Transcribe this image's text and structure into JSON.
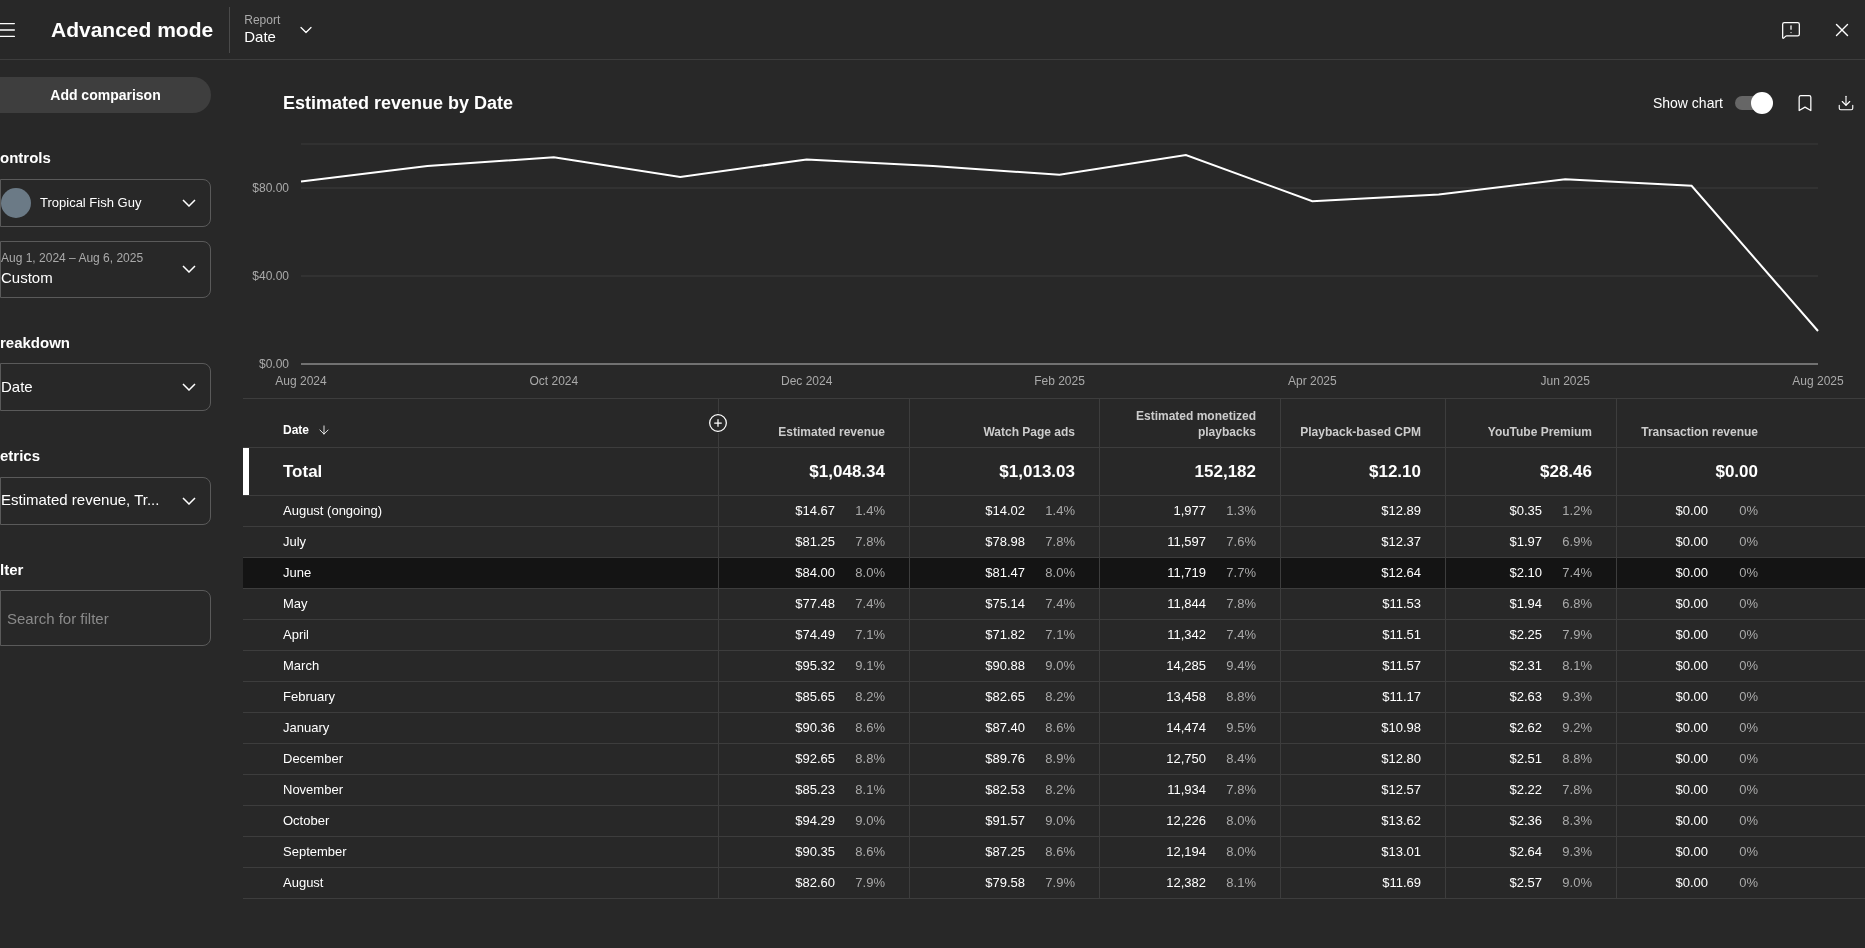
{
  "top_bar": {
    "title": "Advanced mode",
    "report_label": "Report",
    "report_value": "Date"
  },
  "sidebar": {
    "add_button": "Add comparison",
    "sections": [
      {
        "heading": "ontrols",
        "dropdowns": [
          {
            "kind": "channel",
            "value": "Tropical Fish Guy"
          },
          {
            "kind": "range",
            "caption": "Aug 1, 2024 – Aug 6, 2025",
            "value": "Custom"
          }
        ]
      },
      {
        "heading": "reakdown",
        "dropdowns": [
          {
            "kind": "plain",
            "value": "Date"
          }
        ]
      },
      {
        "heading": "etrics",
        "dropdowns": [
          {
            "kind": "plain",
            "value": "Estimated revenue, Tr..."
          }
        ]
      },
      {
        "heading": "lter",
        "dropdowns": [
          {
            "kind": "search",
            "placeholder": "Search for filter"
          }
        ]
      }
    ]
  },
  "chart": {
    "title": "Estimated revenue by Date",
    "show_chart_label": "Show chart",
    "show_chart_on": true,
    "chart_data": {
      "type": "line",
      "categories": [
        "Aug 2024",
        null,
        "Oct 2024",
        null,
        "Dec 2024",
        null,
        "Feb 2025",
        null,
        "Apr 2025",
        null,
        "Jun 2025",
        null,
        "Aug 2025"
      ],
      "series": [
        {
          "color": "#ffffff",
          "values": [
            83,
            90,
            94,
            85,
            93,
            90,
            86,
            95,
            74,
            77,
            84,
            81,
            15
          ]
        }
      ],
      "ylim": [
        0,
        100
      ],
      "yticks": [
        {
          "value": 0,
          "label": "$0.00"
        },
        {
          "value": 40,
          "label": "$40.00"
        },
        {
          "value": 80,
          "label": "$80.00"
        }
      ]
    }
  },
  "table": {
    "date_column": "Date",
    "columns": [
      {
        "heading": "Estimated revenue"
      },
      {
        "heading": "Watch Page ads"
      },
      {
        "heading": "Estimated monetized playbacks"
      },
      {
        "heading": "Playback-based CPM"
      },
      {
        "heading": "YouTube Premium"
      },
      {
        "heading": "Transaction revenue"
      }
    ],
    "total": {
      "label": "Total",
      "values": [
        "$1,048.34",
        "$1,013.03",
        "152,182",
        "$12.10",
        "$28.46",
        "$0.00"
      ]
    },
    "rows": [
      {
        "label": "August (ongoing)",
        "selected": false,
        "cells": [
          [
            "$14.67",
            "1.4%"
          ],
          [
            "$14.02",
            "1.4%"
          ],
          [
            "1,977",
            "1.3%"
          ],
          [
            "$12.89"
          ],
          [
            "$0.35",
            "1.2%"
          ],
          [
            "$0.00",
            "0%"
          ]
        ]
      },
      {
        "label": "July",
        "selected": false,
        "cells": [
          [
            "$81.25",
            "7.8%"
          ],
          [
            "$78.98",
            "7.8%"
          ],
          [
            "11,597",
            "7.6%"
          ],
          [
            "$12.37"
          ],
          [
            "$1.97",
            "6.9%"
          ],
          [
            "$0.00",
            "0%"
          ]
        ]
      },
      {
        "label": "June",
        "selected": true,
        "cells": [
          [
            "$84.00",
            "8.0%"
          ],
          [
            "$81.47",
            "8.0%"
          ],
          [
            "11,719",
            "7.7%"
          ],
          [
            "$12.64"
          ],
          [
            "$2.10",
            "7.4%"
          ],
          [
            "$0.00",
            "0%"
          ]
        ]
      },
      {
        "label": "May",
        "selected": false,
        "cells": [
          [
            "$77.48",
            "7.4%"
          ],
          [
            "$75.14",
            "7.4%"
          ],
          [
            "11,844",
            "7.8%"
          ],
          [
            "$11.53"
          ],
          [
            "$1.94",
            "6.8%"
          ],
          [
            "$0.00",
            "0%"
          ]
        ]
      },
      {
        "label": "April",
        "selected": false,
        "cells": [
          [
            "$74.49",
            "7.1%"
          ],
          [
            "$71.82",
            "7.1%"
          ],
          [
            "11,342",
            "7.4%"
          ],
          [
            "$11.51"
          ],
          [
            "$2.25",
            "7.9%"
          ],
          [
            "$0.00",
            "0%"
          ]
        ]
      },
      {
        "label": "March",
        "selected": false,
        "cells": [
          [
            "$95.32",
            "9.1%"
          ],
          [
            "$90.88",
            "9.0%"
          ],
          [
            "14,285",
            "9.4%"
          ],
          [
            "$11.57"
          ],
          [
            "$2.31",
            "8.1%"
          ],
          [
            "$0.00",
            "0%"
          ]
        ]
      },
      {
        "label": "February",
        "selected": false,
        "cells": [
          [
            "$85.65",
            "8.2%"
          ],
          [
            "$82.65",
            "8.2%"
          ],
          [
            "13,458",
            "8.8%"
          ],
          [
            "$11.17"
          ],
          [
            "$2.63",
            "9.3%"
          ],
          [
            "$0.00",
            "0%"
          ]
        ]
      },
      {
        "label": "January",
        "selected": false,
        "cells": [
          [
            "$90.36",
            "8.6%"
          ],
          [
            "$87.40",
            "8.6%"
          ],
          [
            "14,474",
            "9.5%"
          ],
          [
            "$10.98"
          ],
          [
            "$2.62",
            "9.2%"
          ],
          [
            "$0.00",
            "0%"
          ]
        ]
      },
      {
        "label": "December",
        "selected": false,
        "cells": [
          [
            "$92.65",
            "8.8%"
          ],
          [
            "$89.76",
            "8.9%"
          ],
          [
            "12,750",
            "8.4%"
          ],
          [
            "$12.80"
          ],
          [
            "$2.51",
            "8.8%"
          ],
          [
            "$0.00",
            "0%"
          ]
        ]
      },
      {
        "label": "November",
        "selected": false,
        "cells": [
          [
            "$85.23",
            "8.1%"
          ],
          [
            "$82.53",
            "8.2%"
          ],
          [
            "11,934",
            "7.8%"
          ],
          [
            "$12.57"
          ],
          [
            "$2.22",
            "7.8%"
          ],
          [
            "$0.00",
            "0%"
          ]
        ]
      },
      {
        "label": "October",
        "selected": false,
        "cells": [
          [
            "$94.29",
            "9.0%"
          ],
          [
            "$91.57",
            "9.0%"
          ],
          [
            "12,226",
            "8.0%"
          ],
          [
            "$13.62"
          ],
          [
            "$2.36",
            "8.3%"
          ],
          [
            "$0.00",
            "0%"
          ]
        ]
      },
      {
        "label": "September",
        "selected": false,
        "cells": [
          [
            "$90.35",
            "8.6%"
          ],
          [
            "$87.25",
            "8.6%"
          ],
          [
            "12,194",
            "8.0%"
          ],
          [
            "$13.01"
          ],
          [
            "$2.64",
            "9.3%"
          ],
          [
            "$0.00",
            "0%"
          ]
        ]
      },
      {
        "label": "August",
        "selected": false,
        "cells": [
          [
            "$82.60",
            "7.9%"
          ],
          [
            "$79.58",
            "7.9%"
          ],
          [
            "12,382",
            "8.1%"
          ],
          [
            "$11.69"
          ],
          [
            "$2.57",
            "9.0%"
          ],
          [
            "$0.00",
            "0%"
          ]
        ]
      }
    ]
  }
}
